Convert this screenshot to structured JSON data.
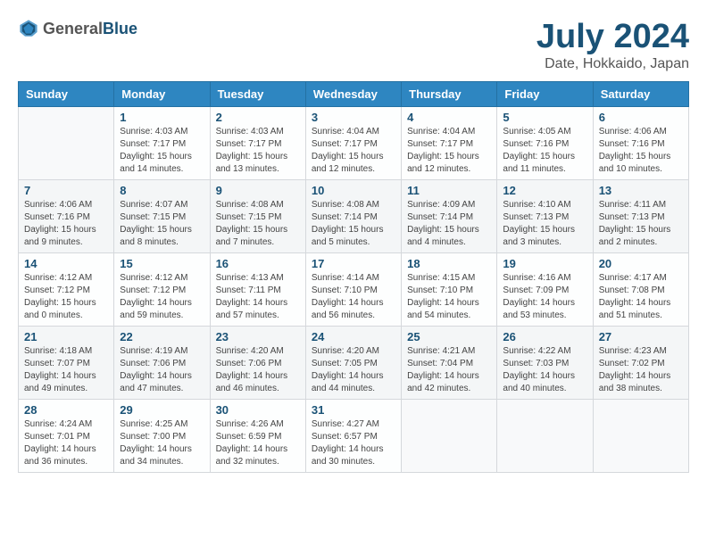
{
  "header": {
    "logo": {
      "general": "General",
      "blue": "Blue"
    },
    "title": "July 2024",
    "subtitle": "Date, Hokkaido, Japan"
  },
  "calendar": {
    "days_of_week": [
      "Sunday",
      "Monday",
      "Tuesday",
      "Wednesday",
      "Thursday",
      "Friday",
      "Saturday"
    ],
    "weeks": [
      [
        {
          "day": "",
          "info": ""
        },
        {
          "day": "1",
          "info": "Sunrise: 4:03 AM\nSunset: 7:17 PM\nDaylight: 15 hours\nand 14 minutes."
        },
        {
          "day": "2",
          "info": "Sunrise: 4:03 AM\nSunset: 7:17 PM\nDaylight: 15 hours\nand 13 minutes."
        },
        {
          "day": "3",
          "info": "Sunrise: 4:04 AM\nSunset: 7:17 PM\nDaylight: 15 hours\nand 12 minutes."
        },
        {
          "day": "4",
          "info": "Sunrise: 4:04 AM\nSunset: 7:17 PM\nDaylight: 15 hours\nand 12 minutes."
        },
        {
          "day": "5",
          "info": "Sunrise: 4:05 AM\nSunset: 7:16 PM\nDaylight: 15 hours\nand 11 minutes."
        },
        {
          "day": "6",
          "info": "Sunrise: 4:06 AM\nSunset: 7:16 PM\nDaylight: 15 hours\nand 10 minutes."
        }
      ],
      [
        {
          "day": "7",
          "info": "Sunrise: 4:06 AM\nSunset: 7:16 PM\nDaylight: 15 hours\nand 9 minutes."
        },
        {
          "day": "8",
          "info": "Sunrise: 4:07 AM\nSunset: 7:15 PM\nDaylight: 15 hours\nand 8 minutes."
        },
        {
          "day": "9",
          "info": "Sunrise: 4:08 AM\nSunset: 7:15 PM\nDaylight: 15 hours\nand 7 minutes."
        },
        {
          "day": "10",
          "info": "Sunrise: 4:08 AM\nSunset: 7:14 PM\nDaylight: 15 hours\nand 5 minutes."
        },
        {
          "day": "11",
          "info": "Sunrise: 4:09 AM\nSunset: 7:14 PM\nDaylight: 15 hours\nand 4 minutes."
        },
        {
          "day": "12",
          "info": "Sunrise: 4:10 AM\nSunset: 7:13 PM\nDaylight: 15 hours\nand 3 minutes."
        },
        {
          "day": "13",
          "info": "Sunrise: 4:11 AM\nSunset: 7:13 PM\nDaylight: 15 hours\nand 2 minutes."
        }
      ],
      [
        {
          "day": "14",
          "info": "Sunrise: 4:12 AM\nSunset: 7:12 PM\nDaylight: 15 hours\nand 0 minutes."
        },
        {
          "day": "15",
          "info": "Sunrise: 4:12 AM\nSunset: 7:12 PM\nDaylight: 14 hours\nand 59 minutes."
        },
        {
          "day": "16",
          "info": "Sunrise: 4:13 AM\nSunset: 7:11 PM\nDaylight: 14 hours\nand 57 minutes."
        },
        {
          "day": "17",
          "info": "Sunrise: 4:14 AM\nSunset: 7:10 PM\nDaylight: 14 hours\nand 56 minutes."
        },
        {
          "day": "18",
          "info": "Sunrise: 4:15 AM\nSunset: 7:10 PM\nDaylight: 14 hours\nand 54 minutes."
        },
        {
          "day": "19",
          "info": "Sunrise: 4:16 AM\nSunset: 7:09 PM\nDaylight: 14 hours\nand 53 minutes."
        },
        {
          "day": "20",
          "info": "Sunrise: 4:17 AM\nSunset: 7:08 PM\nDaylight: 14 hours\nand 51 minutes."
        }
      ],
      [
        {
          "day": "21",
          "info": "Sunrise: 4:18 AM\nSunset: 7:07 PM\nDaylight: 14 hours\nand 49 minutes."
        },
        {
          "day": "22",
          "info": "Sunrise: 4:19 AM\nSunset: 7:06 PM\nDaylight: 14 hours\nand 47 minutes."
        },
        {
          "day": "23",
          "info": "Sunrise: 4:20 AM\nSunset: 7:06 PM\nDaylight: 14 hours\nand 46 minutes."
        },
        {
          "day": "24",
          "info": "Sunrise: 4:20 AM\nSunset: 7:05 PM\nDaylight: 14 hours\nand 44 minutes."
        },
        {
          "day": "25",
          "info": "Sunrise: 4:21 AM\nSunset: 7:04 PM\nDaylight: 14 hours\nand 42 minutes."
        },
        {
          "day": "26",
          "info": "Sunrise: 4:22 AM\nSunset: 7:03 PM\nDaylight: 14 hours\nand 40 minutes."
        },
        {
          "day": "27",
          "info": "Sunrise: 4:23 AM\nSunset: 7:02 PM\nDaylight: 14 hours\nand 38 minutes."
        }
      ],
      [
        {
          "day": "28",
          "info": "Sunrise: 4:24 AM\nSunset: 7:01 PM\nDaylight: 14 hours\nand 36 minutes."
        },
        {
          "day": "29",
          "info": "Sunrise: 4:25 AM\nSunset: 7:00 PM\nDaylight: 14 hours\nand 34 minutes."
        },
        {
          "day": "30",
          "info": "Sunrise: 4:26 AM\nSunset: 6:59 PM\nDaylight: 14 hours\nand 32 minutes."
        },
        {
          "day": "31",
          "info": "Sunrise: 4:27 AM\nSunset: 6:57 PM\nDaylight: 14 hours\nand 30 minutes."
        },
        {
          "day": "",
          "info": ""
        },
        {
          "day": "",
          "info": ""
        },
        {
          "day": "",
          "info": ""
        }
      ]
    ]
  }
}
